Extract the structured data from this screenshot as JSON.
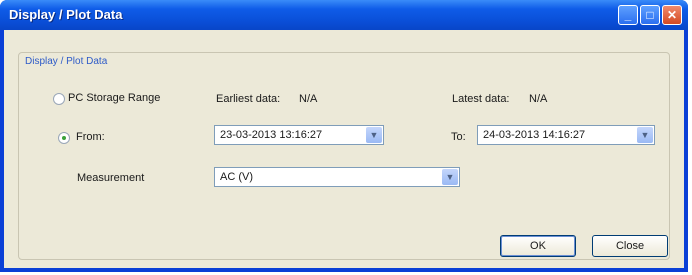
{
  "window": {
    "title": "Display / Plot Data",
    "controls": {
      "minimize": "_",
      "maximize": "□",
      "close": "✕"
    }
  },
  "group": {
    "label": "Display / Plot Data"
  },
  "options": {
    "pc_storage_range_label": "PC Storage Range",
    "from_label": "From:",
    "selected": "from"
  },
  "dates": {
    "earliest_label": "Earliest data:",
    "earliest_value": "N/A",
    "latest_label": "Latest data:",
    "latest_value": "N/A",
    "from_value": "23-03-2013 13:16:27",
    "to_label": "To:",
    "to_value": "24-03-2013 14:16:27"
  },
  "measurement": {
    "label": "Measurement",
    "value": "AC (V)"
  },
  "buttons": {
    "ok": "OK",
    "close": "Close"
  },
  "icons": {
    "dropdown": "chevron-down-icon"
  }
}
